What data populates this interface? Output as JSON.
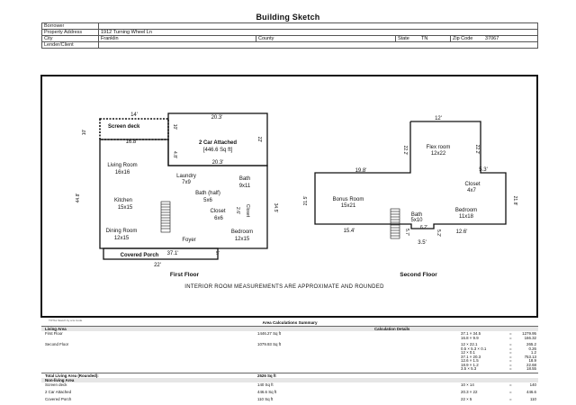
{
  "title": "Building Sketch",
  "info": {
    "borrower_label": "Borrower",
    "address_label": "Property Address",
    "address": "1912 Turning Wheel Ln",
    "city_label": "City",
    "city": "Franklin",
    "county_label": "County",
    "state_label": "State",
    "state": "TN",
    "zip_label": "Zip Code",
    "zip": "37067",
    "lender_label": "Lender/Client"
  },
  "sketch": {
    "first_floor": {
      "label": "First Floor",
      "dims": {
        "top_14": "14'",
        "top_203": "20.3'",
        "deck_left": "10'",
        "deck_mid": "10'",
        "deck_bottom": "16.8'",
        "garage_right": "22'",
        "garage_left": "4.8'",
        "garage_bottom": "20.3'",
        "left_448": "44.8'",
        "right_345": "34.5'",
        "closet_wall": "Closet",
        "closet_24": "2.6'",
        "bottom_371": "37.1'",
        "porch_5": "5'",
        "porch_22": "22'"
      },
      "rooms": {
        "screen_deck": "Screen deck",
        "garage": "2 Car Attached",
        "garage_area": "[446.6 Sq ft]",
        "living": "Living Room",
        "living_dim": "16x16",
        "laundry": "Laundry",
        "laundry_dim": "7x9",
        "bath": "Bath",
        "bath_dim": "9x11",
        "bath_half": "Bath (half)",
        "bath_half_dim": "5x6",
        "kitchen": "Kitchen",
        "kitchen_dim": "15x15",
        "closet": "Closet",
        "closet_dim": "6x6",
        "dining": "Dining Room",
        "dining_dim": "12x15",
        "foyer": "Foyer",
        "bedroom": "Bedroom",
        "bedroom_dim": "12x15",
        "porch": "Covered Porch"
      }
    },
    "second_floor": {
      "label": "Second Floor",
      "dims": {
        "top_12": "12'",
        "flex_left": "22.2'",
        "flex_right": "22.2'",
        "d198": "19.8'",
        "d53": "5.3'",
        "left_215": "21.5'",
        "right_218": "21.8'",
        "d154": "15.4'",
        "d126": "12.6'",
        "d35": "3.5'",
        "d57": "5.7'",
        "d52": "5.2'",
        "d62": "6.2'"
      },
      "rooms": {
        "flex": "Flex room",
        "flex_dim": "12x22",
        "bonus": "Bonus Room",
        "bonus_dim": "15x21",
        "closet": "Closet",
        "closet_dim": "4x7",
        "bedroom": "Bedroom",
        "bedroom_dim": "11x18",
        "bath": "Bath",
        "bath_dim": "5x10"
      }
    },
    "note": "INTERIOR ROOM MEASUREMENTS ARE APPROXIMATE AND ROUNDED"
  },
  "summary": {
    "tiny_note": "TOTAL Sketch by a la mode",
    "title": "Area Calculations Summary",
    "living_area_label": "Living Area",
    "calc_label": "Calculation Details",
    "first_floor_label": "First Floor",
    "first_floor_area": "1446.27 Sq ft",
    "first_calc": [
      {
        "expr": "37.1 × 34.5",
        "val": "1279.95"
      },
      {
        "expr": "16.8 × 9.9",
        "val": "166.32"
      }
    ],
    "second_floor_label": "Second Floor",
    "second_floor_area": "1079.93 Sq ft",
    "second_calc": [
      {
        "expr": "12 × 22.1",
        "val": "265.2"
      },
      {
        "expr": "0.5 × 5.3 × 0.1",
        "val": "0.26"
      },
      {
        "expr": "12 × 0.1",
        "val": "1.2"
      },
      {
        "expr": "37.1 × 20.3",
        "val": "753.13"
      },
      {
        "expr": "12.6 × 1.5",
        "val": "18.9"
      },
      {
        "expr": "18.9 × 1.2",
        "val": "22.68"
      },
      {
        "expr": "3.5 × 5.3",
        "val": "18.55"
      }
    ],
    "total_label": "Total Living Area (Rounded):",
    "total_value": "2526 Sq ft",
    "non_living_label": "Non-living Area",
    "non_living": [
      {
        "name": "Screen deck",
        "area": "140 Sq ft",
        "expr": "10 × 14",
        "val": "140"
      },
      {
        "name": "2 Car Attached",
        "area": "446.6 Sq ft",
        "expr": "20.3 × 22",
        "val": "446.6"
      },
      {
        "name": "Covered Porch",
        "area": "110 Sq ft",
        "expr": "22 × 5",
        "val": "110"
      }
    ]
  }
}
